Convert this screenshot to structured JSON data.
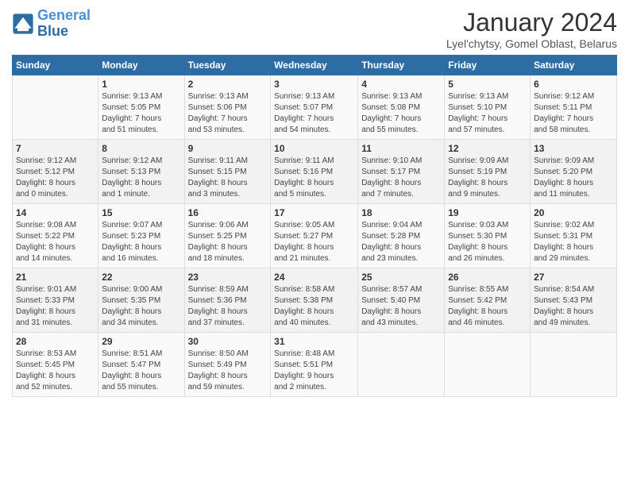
{
  "header": {
    "logo_line1": "General",
    "logo_line2": "Blue",
    "month_title": "January 2024",
    "location": "Lyel'chytsy, Gomel Oblast, Belarus"
  },
  "weekdays": [
    "Sunday",
    "Monday",
    "Tuesday",
    "Wednesday",
    "Thursday",
    "Friday",
    "Saturday"
  ],
  "weeks": [
    [
      {
        "day": "",
        "sunrise": "",
        "sunset": "",
        "daylight": ""
      },
      {
        "day": "1",
        "sunrise": "Sunrise: 9:13 AM",
        "sunset": "Sunset: 5:05 PM",
        "daylight": "Daylight: 7 hours and 51 minutes."
      },
      {
        "day": "2",
        "sunrise": "Sunrise: 9:13 AM",
        "sunset": "Sunset: 5:06 PM",
        "daylight": "Daylight: 7 hours and 53 minutes."
      },
      {
        "day": "3",
        "sunrise": "Sunrise: 9:13 AM",
        "sunset": "Sunset: 5:07 PM",
        "daylight": "Daylight: 7 hours and 54 minutes."
      },
      {
        "day": "4",
        "sunrise": "Sunrise: 9:13 AM",
        "sunset": "Sunset: 5:08 PM",
        "daylight": "Daylight: 7 hours and 55 minutes."
      },
      {
        "day": "5",
        "sunrise": "Sunrise: 9:13 AM",
        "sunset": "Sunset: 5:10 PM",
        "daylight": "Daylight: 7 hours and 57 minutes."
      },
      {
        "day": "6",
        "sunrise": "Sunrise: 9:12 AM",
        "sunset": "Sunset: 5:11 PM",
        "daylight": "Daylight: 7 hours and 58 minutes."
      }
    ],
    [
      {
        "day": "7",
        "sunrise": "Sunrise: 9:12 AM",
        "sunset": "Sunset: 5:12 PM",
        "daylight": "Daylight: 8 hours and 0 minutes."
      },
      {
        "day": "8",
        "sunrise": "Sunrise: 9:12 AM",
        "sunset": "Sunset: 5:13 PM",
        "daylight": "Daylight: 8 hours and 1 minute."
      },
      {
        "day": "9",
        "sunrise": "Sunrise: 9:11 AM",
        "sunset": "Sunset: 5:15 PM",
        "daylight": "Daylight: 8 hours and 3 minutes."
      },
      {
        "day": "10",
        "sunrise": "Sunrise: 9:11 AM",
        "sunset": "Sunset: 5:16 PM",
        "daylight": "Daylight: 8 hours and 5 minutes."
      },
      {
        "day": "11",
        "sunrise": "Sunrise: 9:10 AM",
        "sunset": "Sunset: 5:17 PM",
        "daylight": "Daylight: 8 hours and 7 minutes."
      },
      {
        "day": "12",
        "sunrise": "Sunrise: 9:09 AM",
        "sunset": "Sunset: 5:19 PM",
        "daylight": "Daylight: 8 hours and 9 minutes."
      },
      {
        "day": "13",
        "sunrise": "Sunrise: 9:09 AM",
        "sunset": "Sunset: 5:20 PM",
        "daylight": "Daylight: 8 hours and 11 minutes."
      }
    ],
    [
      {
        "day": "14",
        "sunrise": "Sunrise: 9:08 AM",
        "sunset": "Sunset: 5:22 PM",
        "daylight": "Daylight: 8 hours and 14 minutes."
      },
      {
        "day": "15",
        "sunrise": "Sunrise: 9:07 AM",
        "sunset": "Sunset: 5:23 PM",
        "daylight": "Daylight: 8 hours and 16 minutes."
      },
      {
        "day": "16",
        "sunrise": "Sunrise: 9:06 AM",
        "sunset": "Sunset: 5:25 PM",
        "daylight": "Daylight: 8 hours and 18 minutes."
      },
      {
        "day": "17",
        "sunrise": "Sunrise: 9:05 AM",
        "sunset": "Sunset: 5:27 PM",
        "daylight": "Daylight: 8 hours and 21 minutes."
      },
      {
        "day": "18",
        "sunrise": "Sunrise: 9:04 AM",
        "sunset": "Sunset: 5:28 PM",
        "daylight": "Daylight: 8 hours and 23 minutes."
      },
      {
        "day": "19",
        "sunrise": "Sunrise: 9:03 AM",
        "sunset": "Sunset: 5:30 PM",
        "daylight": "Daylight: 8 hours and 26 minutes."
      },
      {
        "day": "20",
        "sunrise": "Sunrise: 9:02 AM",
        "sunset": "Sunset: 5:31 PM",
        "daylight": "Daylight: 8 hours and 29 minutes."
      }
    ],
    [
      {
        "day": "21",
        "sunrise": "Sunrise: 9:01 AM",
        "sunset": "Sunset: 5:33 PM",
        "daylight": "Daylight: 8 hours and 31 minutes."
      },
      {
        "day": "22",
        "sunrise": "Sunrise: 9:00 AM",
        "sunset": "Sunset: 5:35 PM",
        "daylight": "Daylight: 8 hours and 34 minutes."
      },
      {
        "day": "23",
        "sunrise": "Sunrise: 8:59 AM",
        "sunset": "Sunset: 5:36 PM",
        "daylight": "Daylight: 8 hours and 37 minutes."
      },
      {
        "day": "24",
        "sunrise": "Sunrise: 8:58 AM",
        "sunset": "Sunset: 5:38 PM",
        "daylight": "Daylight: 8 hours and 40 minutes."
      },
      {
        "day": "25",
        "sunrise": "Sunrise: 8:57 AM",
        "sunset": "Sunset: 5:40 PM",
        "daylight": "Daylight: 8 hours and 43 minutes."
      },
      {
        "day": "26",
        "sunrise": "Sunrise: 8:55 AM",
        "sunset": "Sunset: 5:42 PM",
        "daylight": "Daylight: 8 hours and 46 minutes."
      },
      {
        "day": "27",
        "sunrise": "Sunrise: 8:54 AM",
        "sunset": "Sunset: 5:43 PM",
        "daylight": "Daylight: 8 hours and 49 minutes."
      }
    ],
    [
      {
        "day": "28",
        "sunrise": "Sunrise: 8:53 AM",
        "sunset": "Sunset: 5:45 PM",
        "daylight": "Daylight: 8 hours and 52 minutes."
      },
      {
        "day": "29",
        "sunrise": "Sunrise: 8:51 AM",
        "sunset": "Sunset: 5:47 PM",
        "daylight": "Daylight: 8 hours and 55 minutes."
      },
      {
        "day": "30",
        "sunrise": "Sunrise: 8:50 AM",
        "sunset": "Sunset: 5:49 PM",
        "daylight": "Daylight: 8 hours and 59 minutes."
      },
      {
        "day": "31",
        "sunrise": "Sunrise: 8:48 AM",
        "sunset": "Sunset: 5:51 PM",
        "daylight": "Daylight: 9 hours and 2 minutes."
      },
      {
        "day": "",
        "sunrise": "",
        "sunset": "",
        "daylight": ""
      },
      {
        "day": "",
        "sunrise": "",
        "sunset": "",
        "daylight": ""
      },
      {
        "day": "",
        "sunrise": "",
        "sunset": "",
        "daylight": ""
      }
    ]
  ]
}
